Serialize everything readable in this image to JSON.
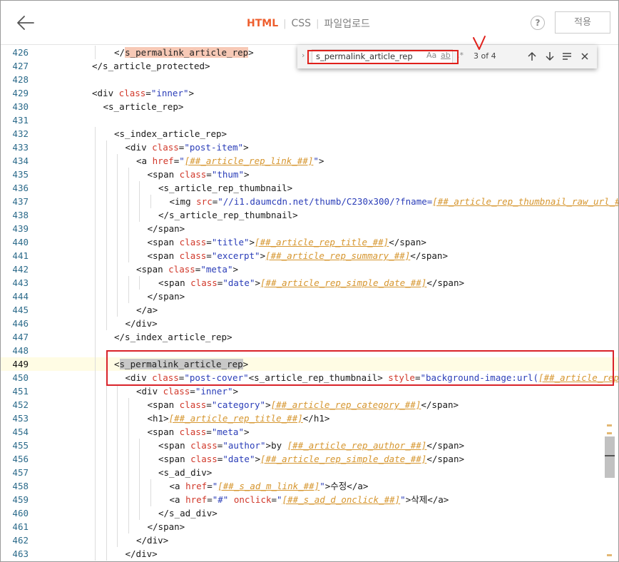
{
  "header": {
    "tabs": [
      {
        "label": "HTML",
        "active": true
      },
      {
        "label": "CSS",
        "active": false
      },
      {
        "label": "파일업로드",
        "active": false
      }
    ],
    "help_label": "?",
    "apply_label": "적용"
  },
  "find": {
    "value": "s_permalink_article_rep",
    "match_case": "Aa",
    "whole_word": "ab",
    "regex": ".*",
    "count": "3 of 4"
  },
  "colors": {
    "accent": "#ee5e2d",
    "annotation": "#e0201b",
    "template": "#d6962f"
  },
  "editor": {
    "current_line": 449,
    "lines": [
      {
        "n": "426",
        "indent": 6,
        "tokens": [
          [
            "plain",
            "</"
          ],
          [
            "hl",
            "s_permalink_article_rep"
          ],
          [
            "plain",
            ">"
          ]
        ]
      },
      {
        "n": "427",
        "indent": 4,
        "tokens": [
          [
            "plain",
            "</s_article_protected>"
          ]
        ]
      },
      {
        "n": "428",
        "indent": 0,
        "tokens": []
      },
      {
        "n": "429",
        "indent": 4,
        "tokens": [
          [
            "plain",
            "<div "
          ],
          [
            "attr",
            "class"
          ],
          [
            "plain",
            "="
          ],
          [
            "str",
            "\"inner\""
          ],
          [
            "plain",
            ">"
          ]
        ]
      },
      {
        "n": "430",
        "indent": 5,
        "tokens": [
          [
            "plain",
            "<s_article_rep>"
          ]
        ]
      },
      {
        "n": "431",
        "indent": 0,
        "tokens": []
      },
      {
        "n": "432",
        "indent": 6,
        "tokens": [
          [
            "plain",
            "<s_index_article_rep>"
          ]
        ]
      },
      {
        "n": "433",
        "indent": 7,
        "tokens": [
          [
            "plain",
            "<div "
          ],
          [
            "attr",
            "class"
          ],
          [
            "plain",
            "="
          ],
          [
            "str",
            "\"post-item\""
          ],
          [
            "plain",
            ">"
          ]
        ]
      },
      {
        "n": "434",
        "indent": 8,
        "tokens": [
          [
            "plain",
            "<a "
          ],
          [
            "attr",
            "href"
          ],
          [
            "plain",
            "="
          ],
          [
            "str",
            "\""
          ],
          [
            "tpl",
            "[##_article_rep_link_##]"
          ],
          [
            "str",
            "\""
          ],
          [
            "plain",
            ">"
          ]
        ]
      },
      {
        "n": "435",
        "indent": 9,
        "tokens": [
          [
            "plain",
            "<span "
          ],
          [
            "attr",
            "class"
          ],
          [
            "plain",
            "="
          ],
          [
            "str",
            "\"thum\""
          ],
          [
            "plain",
            ">"
          ]
        ]
      },
      {
        "n": "436",
        "indent": 10,
        "tokens": [
          [
            "plain",
            "<s_article_rep_thumbnail>"
          ]
        ]
      },
      {
        "n": "437",
        "indent": 11,
        "tokens": [
          [
            "plain",
            "<img "
          ],
          [
            "attr",
            "src"
          ],
          [
            "plain",
            "="
          ],
          [
            "str",
            "\"//i1.daumcdn.net/thumb/C230x300/?fname="
          ],
          [
            "tpl",
            "[##_article_rep_thumbnail_raw_url_##]"
          ]
        ]
      },
      {
        "n": "438",
        "indent": 10,
        "tokens": [
          [
            "plain",
            "</s_article_rep_thumbnail>"
          ]
        ]
      },
      {
        "n": "439",
        "indent": 9,
        "tokens": [
          [
            "plain",
            "</span>"
          ]
        ]
      },
      {
        "n": "440",
        "indent": 9,
        "tokens": [
          [
            "plain",
            "<span "
          ],
          [
            "attr",
            "class"
          ],
          [
            "plain",
            "="
          ],
          [
            "str",
            "\"title\""
          ],
          [
            "plain",
            ">"
          ],
          [
            "tpl",
            "[##_article_rep_title_##]"
          ],
          [
            "plain",
            "</span>"
          ]
        ]
      },
      {
        "n": "441",
        "indent": 9,
        "tokens": [
          [
            "plain",
            "<span "
          ],
          [
            "attr",
            "class"
          ],
          [
            "plain",
            "="
          ],
          [
            "str",
            "\"excerpt\""
          ],
          [
            "plain",
            ">"
          ],
          [
            "tpl",
            "[##_article_rep_summary_##]"
          ],
          [
            "plain",
            "</span>"
          ]
        ]
      },
      {
        "n": "442",
        "indent": 8,
        "tokens": [
          [
            "plain",
            "<span "
          ],
          [
            "attr",
            "class"
          ],
          [
            "plain",
            "="
          ],
          [
            "str",
            "\"meta\""
          ],
          [
            "plain",
            ">"
          ]
        ]
      },
      {
        "n": "443",
        "indent": 10,
        "tokens": [
          [
            "plain",
            "<span "
          ],
          [
            "attr",
            "class"
          ],
          [
            "plain",
            "="
          ],
          [
            "str",
            "\"date\""
          ],
          [
            "plain",
            ">"
          ],
          [
            "tpl",
            "[##_article_rep_simple_date_##]"
          ],
          [
            "plain",
            "</span>"
          ]
        ]
      },
      {
        "n": "444",
        "indent": 9,
        "tokens": [
          [
            "plain",
            "</span>"
          ]
        ]
      },
      {
        "n": "445",
        "indent": 8,
        "tokens": [
          [
            "plain",
            "</a>"
          ]
        ]
      },
      {
        "n": "446",
        "indent": 7,
        "tokens": [
          [
            "plain",
            "</div>"
          ]
        ]
      },
      {
        "n": "447",
        "indent": 6,
        "tokens": [
          [
            "plain",
            "</s_index_article_rep>"
          ]
        ]
      },
      {
        "n": "448",
        "indent": 0,
        "tokens": []
      },
      {
        "n": "449",
        "indent": 6,
        "tokens": [
          [
            "plain",
            "<"
          ],
          [
            "hlc",
            "s_permalink_article_rep"
          ],
          [
            "plain",
            ">"
          ]
        ]
      },
      {
        "n": "450",
        "indent": 7,
        "tokens": [
          [
            "plain",
            "<div "
          ],
          [
            "attr",
            "class"
          ],
          [
            "plain",
            "="
          ],
          [
            "str",
            "\"post-cover\""
          ],
          [
            "plain",
            "<s_article_rep_thumbnail> "
          ],
          [
            "attr",
            "style"
          ],
          [
            "plain",
            "="
          ],
          [
            "str",
            "\"background-image:url("
          ],
          [
            "tpl",
            "[##_article_rep_thumbnail_url_##]"
          ]
        ]
      },
      {
        "n": "451",
        "indent": 8,
        "tokens": [
          [
            "plain",
            "<div "
          ],
          [
            "attr",
            "class"
          ],
          [
            "plain",
            "="
          ],
          [
            "str",
            "\"inner\""
          ],
          [
            "plain",
            ">"
          ]
        ]
      },
      {
        "n": "452",
        "indent": 9,
        "tokens": [
          [
            "plain",
            "<span "
          ],
          [
            "attr",
            "class"
          ],
          [
            "plain",
            "="
          ],
          [
            "str",
            "\"category\""
          ],
          [
            "plain",
            ">"
          ],
          [
            "tpl",
            "[##_article_rep_category_##]"
          ],
          [
            "plain",
            "</span>"
          ]
        ]
      },
      {
        "n": "453",
        "indent": 9,
        "tokens": [
          [
            "plain",
            "<h1>"
          ],
          [
            "tpl",
            "[##_article_rep_title_##]"
          ],
          [
            "plain",
            "</h1>"
          ]
        ]
      },
      {
        "n": "454",
        "indent": 9,
        "tokens": [
          [
            "plain",
            "<span "
          ],
          [
            "attr",
            "class"
          ],
          [
            "plain",
            "="
          ],
          [
            "str",
            "\"meta\""
          ],
          [
            "plain",
            ">"
          ]
        ]
      },
      {
        "n": "455",
        "indent": 10,
        "tokens": [
          [
            "plain",
            "<span "
          ],
          [
            "attr",
            "class"
          ],
          [
            "plain",
            "="
          ],
          [
            "str",
            "\"author\""
          ],
          [
            "plain",
            ">by "
          ],
          [
            "tpl",
            "[##_article_rep_author_##]"
          ],
          [
            "plain",
            "</span>"
          ]
        ]
      },
      {
        "n": "456",
        "indent": 10,
        "tokens": [
          [
            "plain",
            "<span "
          ],
          [
            "attr",
            "class"
          ],
          [
            "plain",
            "="
          ],
          [
            "str",
            "\"date\""
          ],
          [
            "plain",
            ">"
          ],
          [
            "tpl",
            "[##_article_rep_simple_date_##]"
          ],
          [
            "plain",
            "</span>"
          ]
        ]
      },
      {
        "n": "457",
        "indent": 10,
        "tokens": [
          [
            "plain",
            "<s_ad_div>"
          ]
        ]
      },
      {
        "n": "458",
        "indent": 11,
        "tokens": [
          [
            "plain",
            "<a "
          ],
          [
            "attr",
            "href"
          ],
          [
            "plain",
            "="
          ],
          [
            "str",
            "\""
          ],
          [
            "tpl",
            "[##_s_ad_m_link_##]"
          ],
          [
            "str",
            "\""
          ],
          [
            "plain",
            ">수정</a>"
          ]
        ]
      },
      {
        "n": "459",
        "indent": 11,
        "tokens": [
          [
            "plain",
            "<a "
          ],
          [
            "attr",
            "href"
          ],
          [
            "plain",
            "="
          ],
          [
            "str",
            "\"#\""
          ],
          [
            "plain",
            " "
          ],
          [
            "attr",
            "onclick"
          ],
          [
            "plain",
            "="
          ],
          [
            "str",
            "\""
          ],
          [
            "tpl",
            "[##_s_ad_d_onclick_##]"
          ],
          [
            "str",
            "\""
          ],
          [
            "plain",
            ">삭제</a>"
          ]
        ]
      },
      {
        "n": "460",
        "indent": 10,
        "tokens": [
          [
            "plain",
            "</s_ad_div>"
          ]
        ]
      },
      {
        "n": "461",
        "indent": 9,
        "tokens": [
          [
            "plain",
            "</span>"
          ]
        ]
      },
      {
        "n": "462",
        "indent": 8,
        "tokens": [
          [
            "plain",
            "</div>"
          ]
        ]
      },
      {
        "n": "463",
        "indent": 7,
        "tokens": [
          [
            "plain",
            "</div>"
          ]
        ]
      }
    ]
  }
}
